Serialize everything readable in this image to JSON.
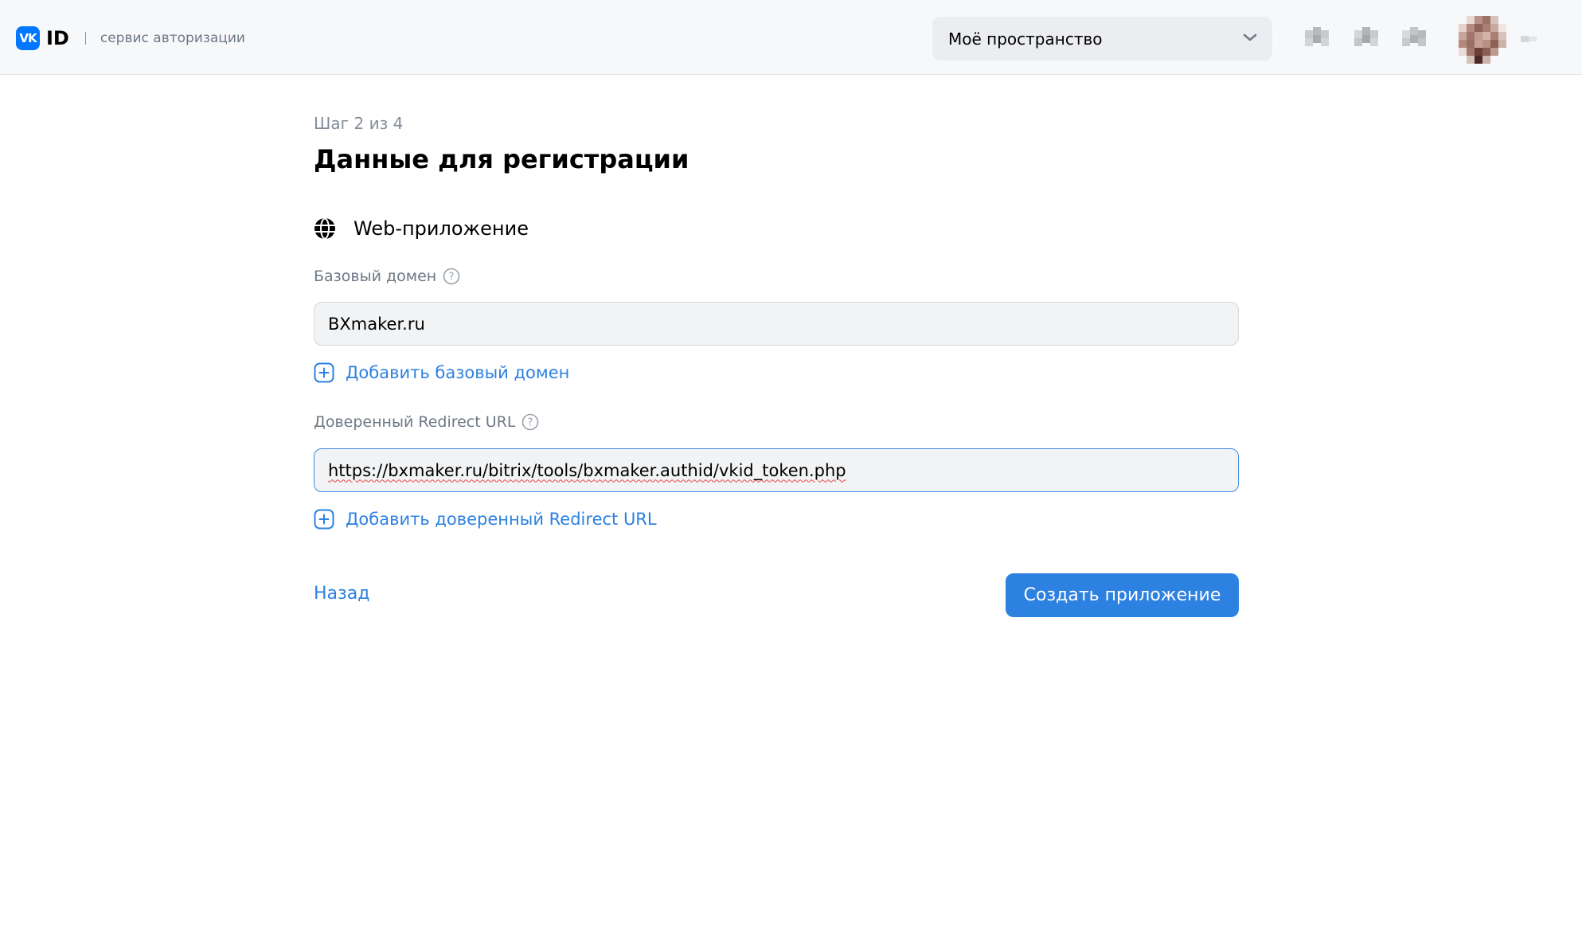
{
  "header": {
    "logo_mark": "VK",
    "logo_id": "ID",
    "service_label": "сервис авторизации",
    "space_select": {
      "value": "Моё пространство",
      "icon": "chevron-down-icon"
    },
    "icons": [
      "blurred-icon-1",
      "blurred-icon-2",
      "blurred-icon-3"
    ],
    "avatar": "avatar-blurred"
  },
  "main": {
    "step": "Шаг 2 из 4",
    "title": "Данные для регистрации",
    "app_type": {
      "icon": "globe-icon",
      "label": "Web-приложение"
    },
    "base_domain": {
      "label": "Базовый домен",
      "value": "BXmaker.ru",
      "add_label": "Добавить базовый домен"
    },
    "redirect": {
      "label": "Доверенный Redirect URL",
      "value": "https://bxmaker.ru/bitrix/tools/bxmaker.authid/vkid_token.php",
      "add_label": "Добавить доверенный Redirect URL"
    },
    "back_label": "Назад",
    "submit_label": "Создать приложение"
  },
  "colors": {
    "accent": "#2d81e0",
    "brand": "#0077ff",
    "header_bg": "#f7f8fa",
    "input_bg": "#f2f3f5",
    "focus_border": "#3f8ae0",
    "muted_text": "#818c99"
  }
}
